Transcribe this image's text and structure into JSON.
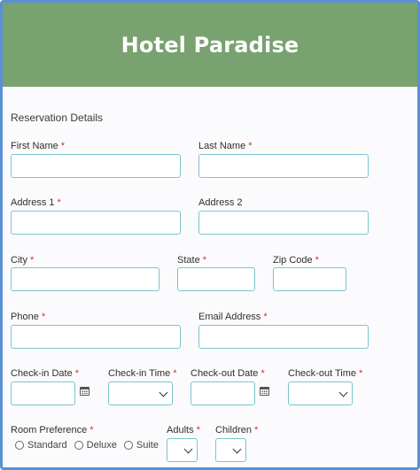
{
  "header": {
    "title": "Hotel Paradise"
  },
  "form": {
    "section_title": "Reservation Details",
    "required_mark": "*",
    "fields": {
      "first_name": "First Name",
      "last_name": "Last Name",
      "address1": "Address 1",
      "address2": "Address 2",
      "city": "City",
      "state": "State",
      "zip": "Zip Code",
      "phone": "Phone",
      "email": "Email Address",
      "checkin_date": "Check-in Date",
      "checkin_time": "Check-in Time",
      "checkout_date": "Check-out Date",
      "checkout_time": "Check-out Time",
      "room_pref": "Room Preference",
      "adults": "Adults",
      "children": "Children"
    },
    "room_options": [
      "Standard",
      "Deluxe",
      "Suite"
    ]
  },
  "colors": {
    "header_bg": "#78a26f",
    "frame_border": "#5b8fd6",
    "input_border": "#7cc4cf",
    "required": "#d32f2f"
  },
  "icons": {
    "calendar": "calendar-icon",
    "dropdown": "chevron-down-icon"
  }
}
